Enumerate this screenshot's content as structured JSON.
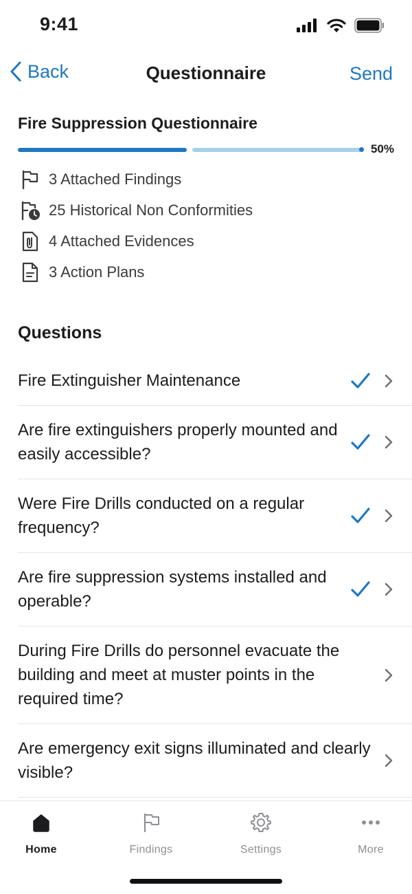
{
  "status_bar": {
    "time": "9:41"
  },
  "nav": {
    "back_label": "Back",
    "title": "Questionnaire",
    "send_label": "Send"
  },
  "questionnaire": {
    "title": "Fire Suppression Questionnaire",
    "progress_label": "50%",
    "progress": 0.5
  },
  "info": [
    {
      "icon": "flag-icon",
      "label": "3 Attached Findings"
    },
    {
      "icon": "flag-clock-icon",
      "label": "25 Historical Non Conformities"
    },
    {
      "icon": "paperclip-document-icon",
      "label": "4 Attached Evidences"
    },
    {
      "icon": "document-icon",
      "label": "3 Action Plans"
    }
  ],
  "questions_title": "Questions",
  "questions": [
    {
      "text": "Fire Extinguisher Maintenance",
      "answered": true
    },
    {
      "text": "Are fire extinguishers properly mounted and easily accessible?",
      "answered": true
    },
    {
      "text": "Were Fire Drills conducted on a regular frequency?",
      "answered": true
    },
    {
      "text": "Are fire suppression systems installed and operable?",
      "answered": true
    },
    {
      "text": "During Fire Drills do personnel evacuate the building and meet at muster points in the required time?",
      "answered": false
    },
    {
      "text": "Are emergency exit signs illuminated and clearly visible?",
      "answered": false
    }
  ],
  "tabs": [
    {
      "label": "Home",
      "icon": "home-icon",
      "active": true
    },
    {
      "label": "Findings",
      "icon": "flag-icon",
      "active": false
    },
    {
      "label": "Settings",
      "icon": "gear-icon",
      "active": false
    },
    {
      "label": "More",
      "icon": "more-icon",
      "active": false
    }
  ],
  "colors": {
    "accent": "#1f78c1",
    "progress_remaining": "#a6d2ea"
  }
}
